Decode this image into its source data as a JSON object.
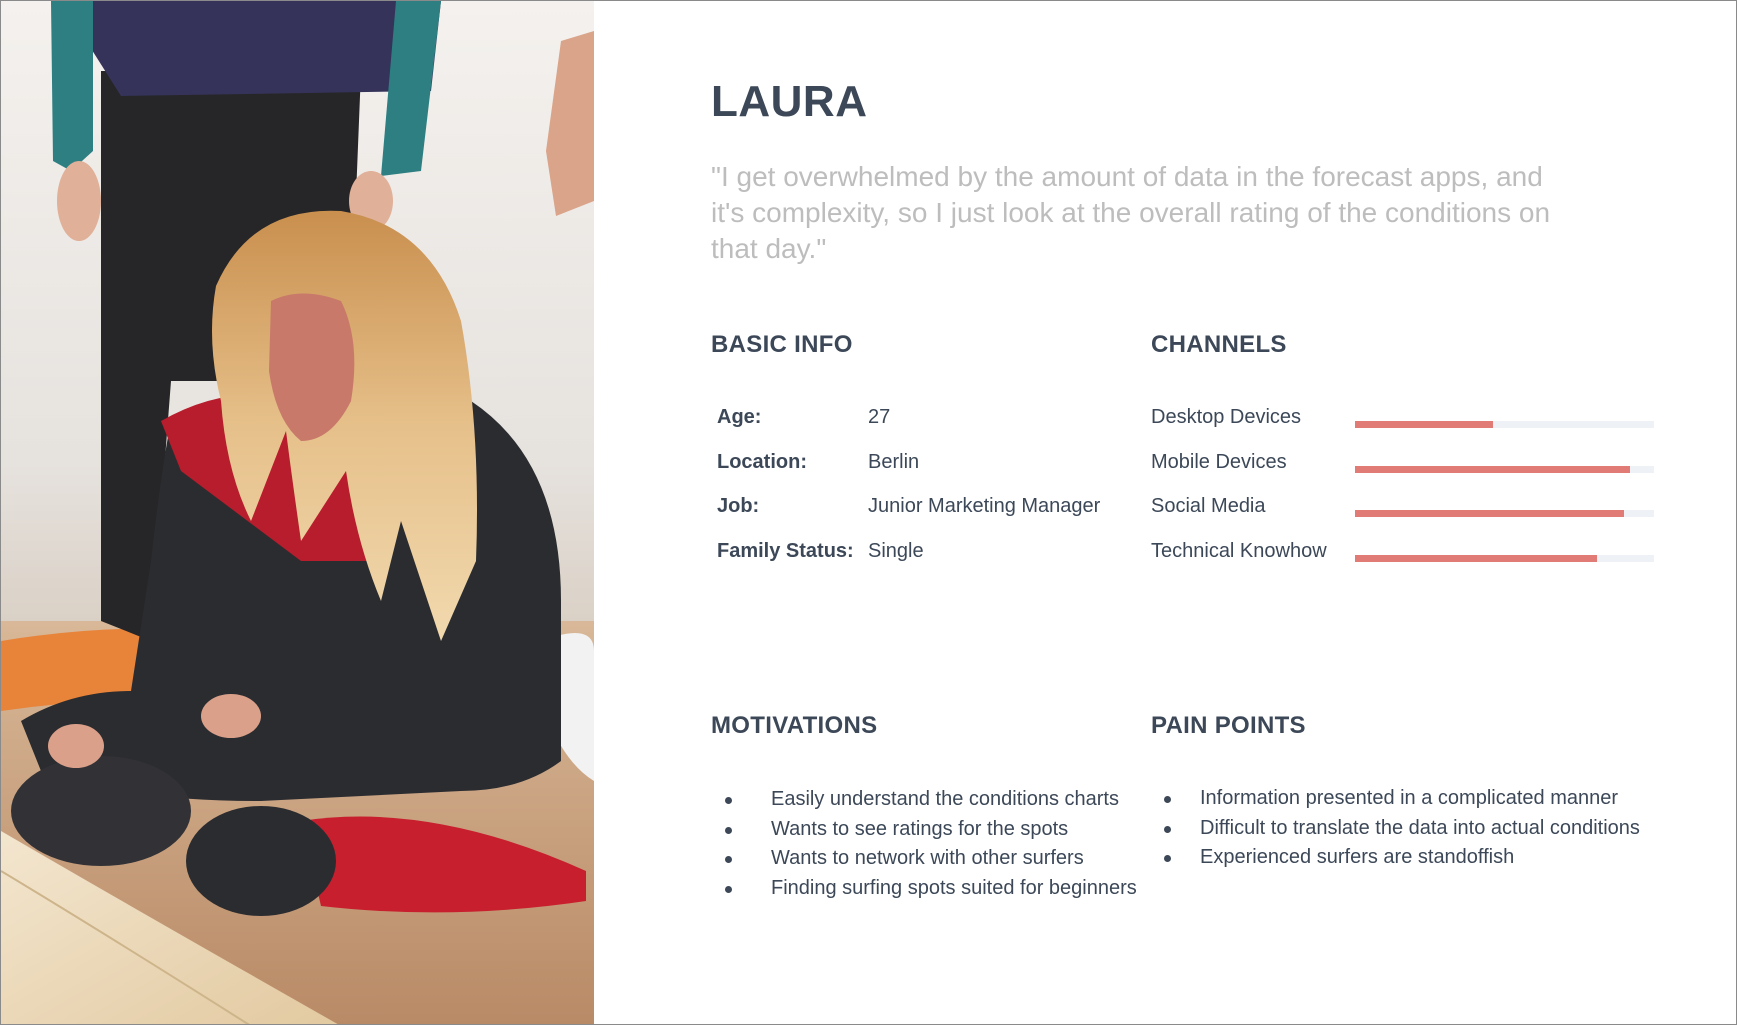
{
  "persona": {
    "name": "LAURA",
    "quote": "\"I get overwhelmed by the amount of data in the forecast apps, and it's complexity, so I just look at the overall rating of the conditions on that day.\""
  },
  "basic_info": {
    "title": "BASIC INFO",
    "rows": [
      {
        "label": "Age:",
        "value": "27"
      },
      {
        "label": "Location:",
        "value": "Berlin"
      },
      {
        "label": "Job:",
        "value": "Junior Marketing Manager"
      },
      {
        "label": "Family Status:",
        "value": "Single"
      }
    ]
  },
  "channels": {
    "title": "CHANNELS",
    "bar_color": "#e07b76",
    "track_color": "#eef2f7",
    "rows": [
      {
        "label": "Desktop Devices",
        "level": 0.46
      },
      {
        "label": "Mobile Devices",
        "level": 0.92
      },
      {
        "label": "Social Media",
        "level": 0.9
      },
      {
        "label": "Technical Knowhow",
        "level": 0.81
      }
    ]
  },
  "motivations": {
    "title": "MOTIVATIONS",
    "items": [
      "Easily understand the conditions charts",
      "Wants to see ratings for the spots",
      "Wants to network with other surfers",
      "Finding surfing spots suited for beginners"
    ]
  },
  "pain_points": {
    "title": "PAIN POINTS",
    "items": [
      "Information presented in a complicated manner",
      "Difficult to translate the data into actual conditions",
      "Experienced surfers are standoffish"
    ]
  }
}
